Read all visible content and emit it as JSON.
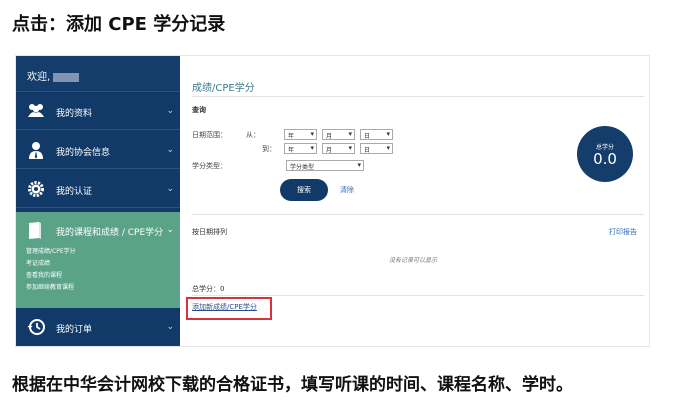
{
  "instruction": {
    "heading": "点击：添加 CPE 学分记录",
    "footer": "根据在中华会计网校下载的合格证书，填写听课的时间、课程名称、学时。"
  },
  "sidebar": {
    "welcome": "欢迎,",
    "items": [
      {
        "label": "我的资料",
        "icon": "users-icon"
      },
      {
        "label": "我的协会信息",
        "icon": "person-icon"
      },
      {
        "label": "我的认证",
        "icon": "gear-icon"
      },
      {
        "label": "我的课程和成绩 / CPE学分",
        "icon": "book-icon"
      },
      {
        "label": "我的订单",
        "icon": "history-icon"
      }
    ],
    "subitems": [
      "管理成绩/CPE学分",
      "考证成绩",
      "查看我的课程",
      "参加继续教育课程"
    ]
  },
  "main": {
    "title": "成绩/CPE学分",
    "query_label": "查询",
    "date_range_label": "日期范围：",
    "from_label": "从：",
    "to_label": "到：",
    "year_option": "年",
    "month_option": "月",
    "day_option": "日",
    "credit_type_label": "学分类型：",
    "credit_type_value": "学分类型",
    "search_button": "搜索",
    "clear_link": "清除",
    "total_credits_label": "总学分",
    "total_credits_value": "0.0",
    "sort_label": "按日期排列",
    "print_link": "打印报告",
    "no_records": "没有记录可以显示",
    "total_line": "总学分：0",
    "add_link": "添加新成绩/CPE学分"
  },
  "colors": {
    "navy": "#123a68",
    "active_green": "#5aa389",
    "highlight_red": "#d9323e",
    "link_blue": "#2a6db3"
  }
}
